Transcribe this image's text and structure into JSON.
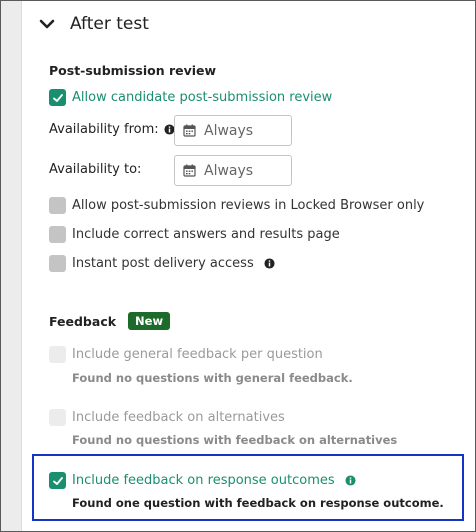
{
  "section": {
    "title": "After test"
  },
  "review": {
    "heading": "Post-submission review",
    "allow_review_label": "Allow candidate post-submission review",
    "availability_from_label": "Availability from:",
    "availability_from_value": "Always",
    "availability_to_label": "Availability to:",
    "availability_to_value": "Always",
    "locked_browser_label": "Allow post-submission reviews in Locked Browser only",
    "correct_answers_label": "Include correct answers and results page",
    "instant_access_label": "Instant post delivery access"
  },
  "feedback": {
    "heading": "Feedback",
    "badge": "New",
    "general_label": "Include general feedback per question",
    "general_note": "Found no questions with general feedback.",
    "alternatives_label": "Include feedback on alternatives",
    "alternatives_note": "Found no questions with feedback on alternatives",
    "outcomes_label": "Include feedback on response outcomes",
    "outcomes_note": "Found one question with feedback on response outcome."
  },
  "colors": {
    "accent_green": "#1a8f70",
    "badge_green": "#1d6b2a",
    "highlight_blue": "#1733c4"
  },
  "icons": {
    "chevron": "chevron-down-icon",
    "calendar": "calendar-icon",
    "info": "info-icon",
    "check": "check-icon"
  }
}
